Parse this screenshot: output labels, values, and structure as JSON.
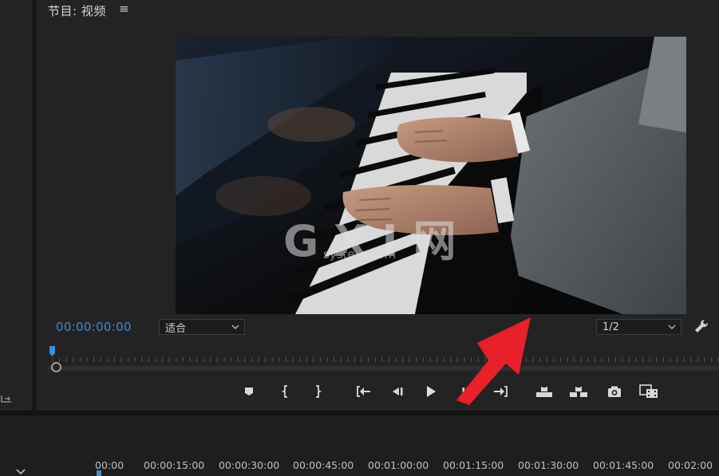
{
  "panel": {
    "title": "节目: 视频",
    "menu_icon": "≡"
  },
  "player": {
    "timecode": "00:00:00:00",
    "fit_select": "适合",
    "resolution_select": "1/2"
  },
  "transport": {
    "buttons": [
      "marker-icon",
      "mark-in-icon",
      "mark-out-icon",
      "go-to-in-icon",
      "step-back-icon",
      "play-icon",
      "step-forward-icon",
      "go-to-out-icon",
      "lift-icon",
      "extract-icon",
      "export-frame-icon",
      "compare-icon"
    ]
  },
  "timeline": {
    "ticks": [
      "00:00",
      "00:00:15:00",
      "00:00:30:00",
      "00:00:45:00",
      "00:01:00:00",
      "00:01:15:00",
      "00:01:30:00",
      "00:01:45:00",
      "00:02:00"
    ]
  },
  "watermark": {
    "brand": "G X I 网",
    "sub": "system.com"
  },
  "colors": {
    "accent": "#3b8ed9",
    "annotation": "#e8202a"
  }
}
